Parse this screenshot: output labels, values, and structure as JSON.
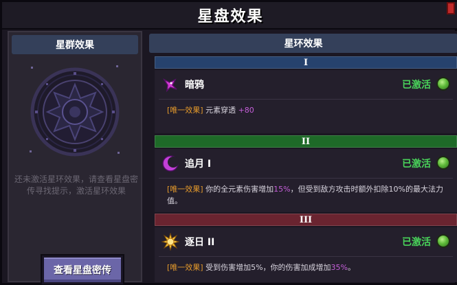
{
  "title": "星盘效果",
  "left": {
    "header": "星群效果",
    "hint": "还未激活星环效果，请查看星盘密传寻找提示，激活星环效果",
    "button": "查看星盘密传"
  },
  "right": {
    "header": "星环效果",
    "sections": [
      {
        "numeral": "I",
        "color": "#26426d",
        "name": "暗鸦",
        "icon": "crow-icon",
        "status": "已激活",
        "tag": "[唯一效果]",
        "effect_pre": "元素穿透",
        "effect_hl": "+80",
        "effect_post": ""
      },
      {
        "numeral": "II",
        "color": "#1e6a28",
        "name": "追月 I",
        "icon": "crescent-moon-icon",
        "status": "已激活",
        "tag": "[唯一效果]",
        "effect_pre": "你的全元素伤害增加",
        "effect_hl": "15%",
        "effect_post": "，但受到敌方攻击时额外扣除10%的最大法力值。"
      },
      {
        "numeral": "III",
        "color": "#6a2430",
        "name": "逐日 II",
        "icon": "sun-icon",
        "status": "已激活",
        "tag": "[唯一效果]",
        "effect_pre": "受到伤害增加5%，你的伤害加成增加",
        "effect_hl": "35%",
        "effect_post": "。"
      }
    ]
  },
  "colors": {
    "active_green": "#49d35a",
    "tag_orange": "#e59a2b",
    "highlight_purple": "#c55fd9",
    "button_purple": "#6b66a8"
  }
}
